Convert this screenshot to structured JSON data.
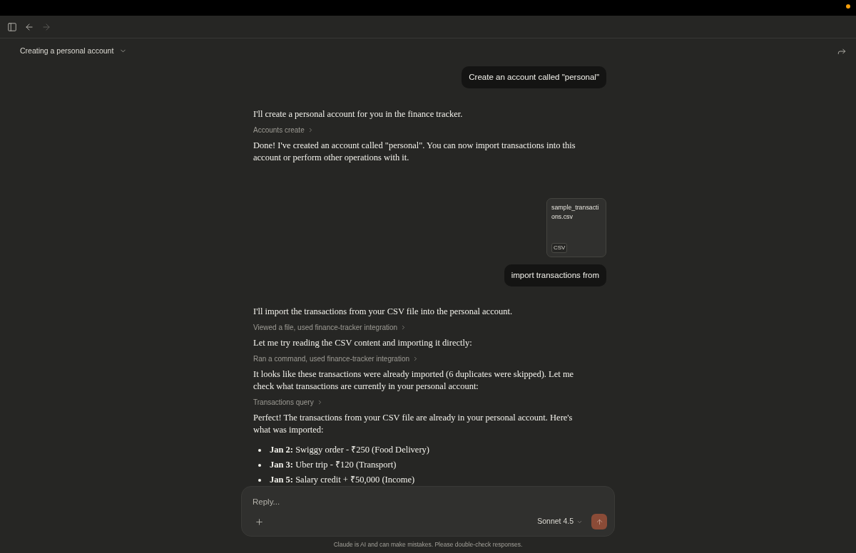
{
  "nav_buttons": [
    {
      "kind": "sidebar",
      "disabled": false
    },
    {
      "kind": "back",
      "disabled": false
    },
    {
      "kind": "forward",
      "disabled": true
    }
  ],
  "conversation": {
    "title": "Creating a personal account"
  },
  "messages": [
    {
      "kind": "user",
      "text": "Create an account called \"personal\""
    },
    {
      "kind": "assistant",
      "blocks": [
        {
          "kind": "text",
          "text": "I'll create a personal account for you in the finance tracker."
        },
        {
          "kind": "tool",
          "label": "Accounts create"
        },
        {
          "kind": "text",
          "text": "Done! I've created an account called \"personal\". You can now import transactions into this account or perform other operations with it."
        }
      ]
    },
    {
      "kind": "user",
      "attachments": [
        {
          "name": "sample_transactions.csv",
          "type": "CSV"
        }
      ],
      "text": "import transactions from"
    },
    {
      "kind": "assistant",
      "blocks": [
        {
          "kind": "text",
          "text": "I'll import the transactions from your CSV file into the personal account."
        },
        {
          "kind": "tool",
          "label": "Viewed a file, used finance-tracker integration"
        },
        {
          "kind": "text",
          "text": "Let me try reading the CSV content and importing it directly:"
        },
        {
          "kind": "tool",
          "label": "Ran a command, used finance-tracker integration"
        },
        {
          "kind": "text",
          "text": "It looks like these transactions were already imported (6 duplicates were skipped). Let me check what transactions are currently in your personal account:"
        },
        {
          "kind": "tool",
          "label": "Transactions query"
        },
        {
          "kind": "text",
          "text": "Perfect! The transactions from your CSV file are already in your personal account. Here's what was imported:"
        },
        {
          "kind": "list",
          "items": [
            "**Jan 2:** Swiggy order - ₹250 (Food Delivery)",
            "**Jan 3:** Uber trip - ₹120 (Transport)",
            "**Jan 5:** Salary credit + ₹50,000 (Income)"
          ]
        }
      ]
    }
  ],
  "composer": {
    "placeholder": "Reply...",
    "model": "Sonnet 4.5",
    "send_disabled": true
  },
  "footer": "Claude is AI and can make mistakes. Please double-check responses."
}
